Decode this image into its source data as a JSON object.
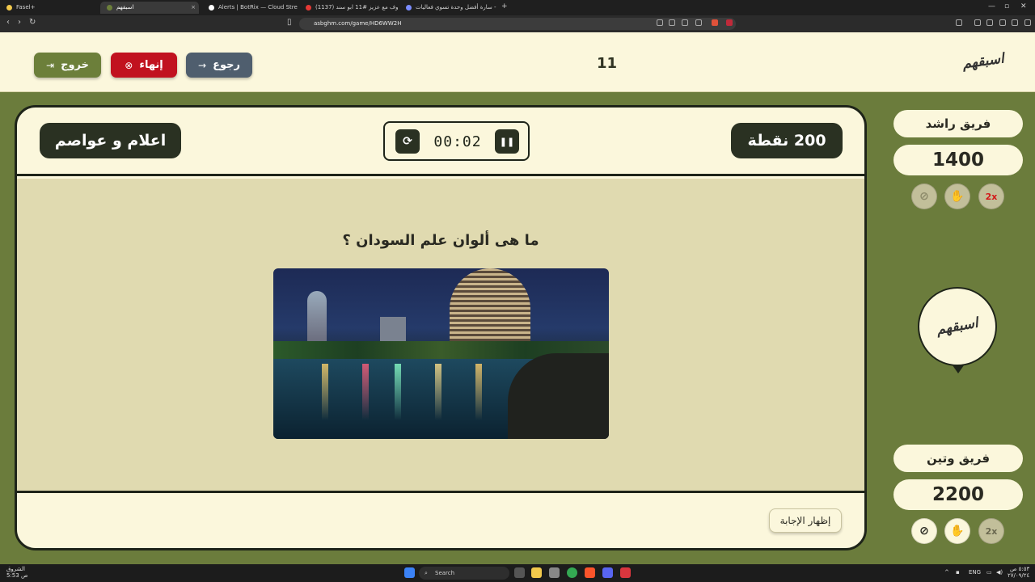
{
  "browser": {
    "tabs": [
      {
        "label": "Fasel+",
        "active": false,
        "color": "#f2c94c"
      },
      {
        "label": "اسبقهم",
        "active": true,
        "color": "#6c7f3a"
      },
      {
        "label": "Alerts | BotRix — Cloud Streaming B",
        "active": false,
        "color": "#ffffff"
      },
      {
        "label": "(1137) حروف مع عزيز #11 ابو سند",
        "active": false,
        "color": "#e53935"
      },
      {
        "label": "سارة أفضل وحدة تسوي فعاليات - :icon",
        "active": false,
        "color": "#7a8cff"
      }
    ],
    "close_glyph": "×",
    "new_tab_glyph": "+",
    "url": "asbghm.com/game/HD6WW2H"
  },
  "header": {
    "round_number": "11",
    "logo_text": "اسبقهم",
    "back_label": "رجوع",
    "end_label": "إنهاء",
    "exit_label": "خروج"
  },
  "card": {
    "points_label": "200 نقطة",
    "category_label": "اعلام و عواصم",
    "timer": "00:02",
    "question": "ما هى ألوان علم السودان ؟",
    "reveal_answer_label": "إظهار الإجابة"
  },
  "teams": [
    {
      "name": "فريق راشد",
      "score": "1400",
      "aids": [
        "no",
        "hand",
        "2x"
      ],
      "aid_states": [
        "used",
        "used",
        "used"
      ]
    },
    {
      "name": "فريق وتين",
      "score": "2200",
      "aids": [
        "no",
        "hand",
        "2x"
      ],
      "aid_states": [
        "ok",
        "ok",
        "used"
      ]
    }
  ],
  "center_logo_text": "اسبقهم",
  "taskbar": {
    "weather_label": "الشروق",
    "weather_sub": "5:53 ص",
    "search_placeholder": "Search",
    "lang": "ENG",
    "time": "٥:٥٣ ص",
    "date": "٢٧/٠٩/٢٤"
  },
  "colors": {
    "background": "#6b7c3c",
    "cream": "#fbf7dc",
    "panel": "#e0dab0",
    "dark": "#2a3122",
    "back_btn": "#4f5e6e",
    "end_btn": "#c1121f",
    "exit_btn": "#6c7f3a"
  }
}
